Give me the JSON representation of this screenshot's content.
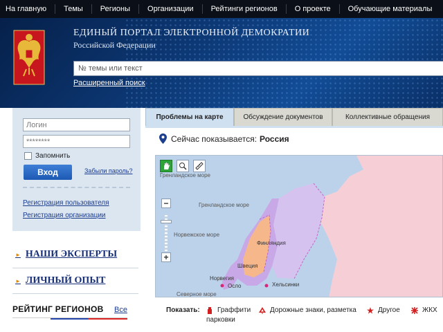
{
  "topnav": {
    "items": [
      "На главную",
      "Темы",
      "Регионы",
      "Организации",
      "Рейтинги регионов",
      "О проекте",
      "Обучающие материалы"
    ]
  },
  "header": {
    "title": "ЕДИНЫЙ ПОРТАЛ ЭЛЕКТРОННОЙ ДЕМОКРАТИИ",
    "subtitle": "Российской Федерации",
    "emblem_icon": "russian-coat-of-arms"
  },
  "search": {
    "placeholder": "№ темы или текст",
    "advanced_link": "Расширенный поиск"
  },
  "login": {
    "login_placeholder": "Логин",
    "password_placeholder": "********",
    "remember_label": "Запомнить",
    "submit_label": "Вход",
    "forgot_link": "Забыли пароль?",
    "register_user": "Регистрация пользователя",
    "register_org": "Регистрация организации"
  },
  "sidebar": {
    "experts": "НАШИ ЭКСПЕРТЫ",
    "experience": "ЛИЧНЫЙ ОПЫТ",
    "rating_title": "РЕЙТИНГ РЕГИОНОВ",
    "rating_all": "Все"
  },
  "tabs": {
    "items": [
      "Проблемы на карте",
      "Обсуждение документов",
      "Коллективные обращения"
    ],
    "active": "Проблемы на карте"
  },
  "location": {
    "prefix": "Сейчас показывается:",
    "value": "Россия"
  },
  "map": {
    "seas": [
      "Гренландское море",
      "Гренландское море",
      "Норвежское море",
      "Северное море"
    ],
    "countries": [
      "Финляндия",
      "Швеция",
      "Норвегия"
    ],
    "cities": [
      "Осло",
      "Хельсинки"
    ],
    "tools": [
      "hand-pan-icon",
      "zoom-area-icon",
      "ruler-icon"
    ]
  },
  "legend": {
    "label": "Показать:",
    "items": [
      {
        "label": "Граффити",
        "label2": "парковки",
        "icon": "graffiti-icon"
      },
      {
        "label": "Дорожные знаки, разметка",
        "icon": "road-sign-icon"
      },
      {
        "label": "Другое",
        "icon": "star-icon"
      },
      {
        "label": "ЖКХ",
        "icon": "utilities-icon"
      }
    ]
  },
  "colors": {
    "topnav_bg": "#0b0f17",
    "header_bg": "#0d3a78",
    "login_bg": "#dbe6f1",
    "link": "#1c3c8c",
    "accent_red": "#d22020",
    "active_tool": "#2fa23a"
  }
}
